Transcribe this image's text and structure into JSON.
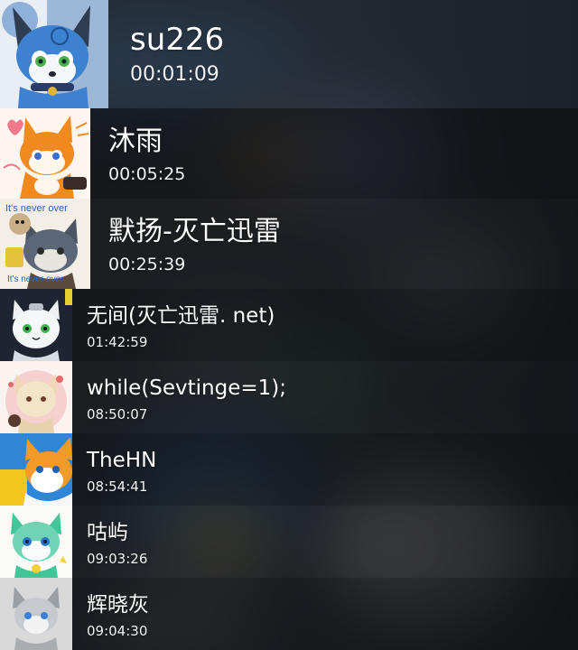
{
  "contacts": [
    {
      "name": "su226",
      "time": "00:01:09",
      "avatar_icon": "blue-fox-avatar-icon"
    },
    {
      "name": "沐雨",
      "time": "00:05:25",
      "avatar_icon": "orange-fox-avatar-icon"
    },
    {
      "name": "默扬-灭亡迅雷",
      "time": "00:25:39",
      "avatar_icon": "grey-wolf-avatar-icon",
      "avatar_caption_top": "It's never over",
      "avatar_caption_bottom": "It's never over"
    },
    {
      "name": "无间(灭亡迅雷. net)",
      "time": "01:42:59",
      "avatar_icon": "white-cat-avatar-icon"
    },
    {
      "name": "while(Sevtinge=1);",
      "time": "08:50:07",
      "avatar_icon": "cream-fox-avatar-icon"
    },
    {
      "name": "TheHN",
      "time": "08:54:41",
      "avatar_icon": "orange-white-fox-avatar-icon"
    },
    {
      "name": "咕屿",
      "time": "09:03:26",
      "avatar_icon": "teal-dragon-avatar-icon"
    },
    {
      "name": "辉晓灰",
      "time": "09:04:30",
      "avatar_icon": "grey-wolf-sketch-avatar-icon"
    }
  ],
  "colors": {
    "text": "#ffffff",
    "backdrop": "#262a2e",
    "avatar1_fur": "#3c82d0",
    "avatar2_fur": "#f08a1f",
    "avatar6_fur": "#f39a28",
    "avatar7_fur": "#43c59a"
  }
}
